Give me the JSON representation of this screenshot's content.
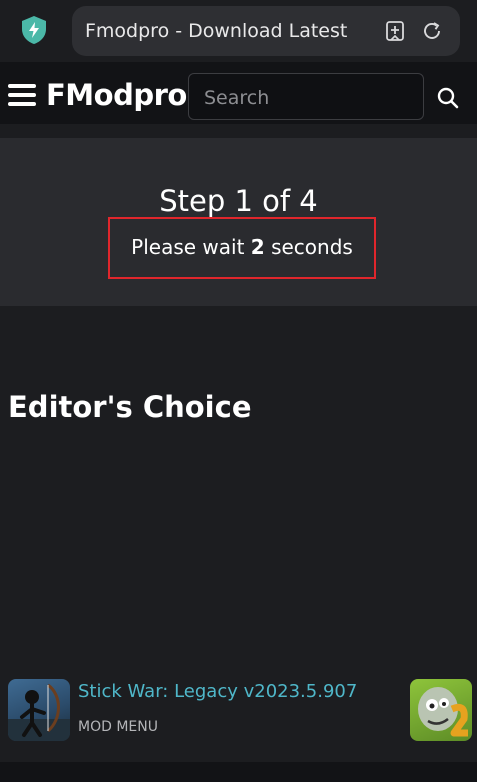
{
  "browser": {
    "url_title": "Fmodpro - Download Latest",
    "icons": [
      "shield-icon",
      "bookmark-icon",
      "reload-icon"
    ]
  },
  "header": {
    "brand": "FModpro",
    "search_placeholder": "Search"
  },
  "step": {
    "title": "Step 1 of 4",
    "wait_prefix": "Please wait ",
    "wait_seconds": "2",
    "wait_suffix": " seconds"
  },
  "editors_choice": {
    "title": "Editor's Choice",
    "items": [
      {
        "name": "Stick War: Legacy v2023.5.907",
        "tag": "MOD MENU"
      }
    ]
  },
  "colors": {
    "background": "#1c1d20",
    "header": "#121316",
    "panel": "#2a2b2f",
    "highlight_border": "#e0262c",
    "link": "#4fb7c9"
  }
}
